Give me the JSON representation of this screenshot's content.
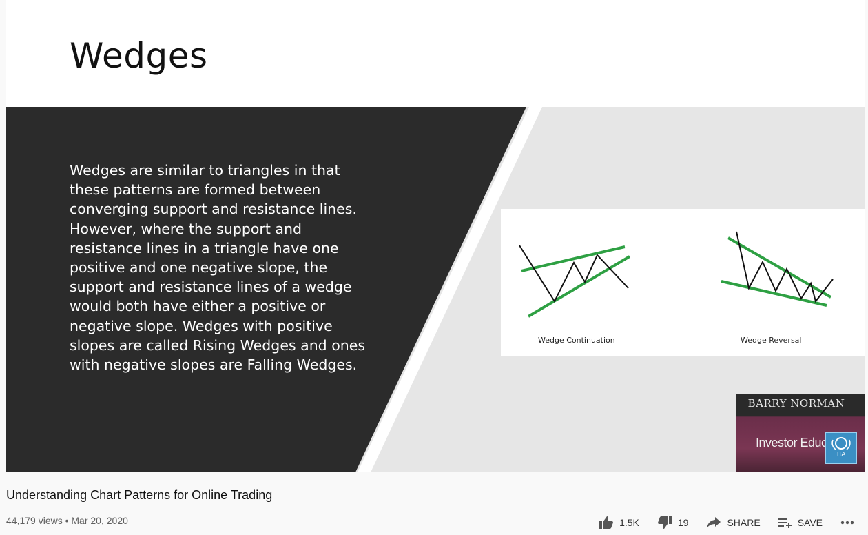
{
  "slide": {
    "title": "Wedges",
    "body": "Wedges are similar to triangles in that these patterns are formed between converging support and resistance lines. However, where the support and resistance lines in a triangle have one positive and one negative slope, the support and resistance lines of a wedge would both have either a positive or negative slope. Wedges with positive slopes are called Rising Wedges and ones with negative slopes are Falling Wedges.",
    "diagram": {
      "left_caption": "Wedge Continuation",
      "right_caption": "Wedge Reversal"
    }
  },
  "presenter": {
    "name": "BARRY NORMAN",
    "subtitle": "Investor Educat",
    "logo_text": "ITA"
  },
  "video": {
    "title": "Understanding Chart Patterns for Online Trading",
    "meta": "44,179 views • Mar 20, 2020"
  },
  "actions": {
    "like_count": "1.5K",
    "dislike_count": "19",
    "share_label": "SHARE",
    "save_label": "SAVE",
    "more_icon": "more-horizontal-icon"
  },
  "colors": {
    "slide_dark": "#2b2b2b",
    "slide_grey": "#e6e6e6",
    "trendline_green": "#2ea043"
  }
}
